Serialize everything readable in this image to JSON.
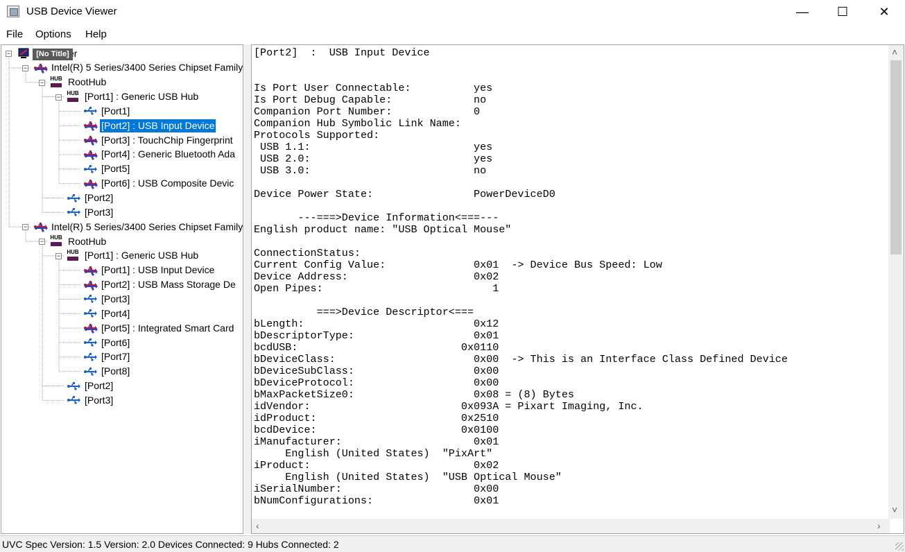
{
  "window": {
    "title": "USB Device Viewer",
    "minimize_glyph": "—",
    "maximize_glyph": "☐",
    "close_glyph": "✕"
  },
  "menu": [
    "File",
    "Options",
    "Help"
  ],
  "tooltip": "[No Title]",
  "tree": {
    "nodes": [
      {
        "label": "Computer",
        "icon": "computer-icon",
        "level": 0,
        "expanded": true
      },
      {
        "label": "Intel(R) 5 Series/3400 Series Chipset Family",
        "icon": "usb-controller-icon",
        "level": 1,
        "expanded": true
      },
      {
        "label": "RootHub",
        "icon": "hub-icon",
        "level": 2,
        "expanded": true
      },
      {
        "label": "[Port1]  :  Generic USB Hub",
        "icon": "hub-icon",
        "level": 3,
        "expanded": true
      },
      {
        "label": "[Port1]",
        "icon": "usb-port-icon",
        "level": 4
      },
      {
        "label": "[Port2]  :  USB Input Device",
        "icon": "usb-device-icon",
        "level": 4,
        "selected": true
      },
      {
        "label": "[Port3]  :  TouchChip Fingerprint",
        "icon": "usb-device-icon",
        "level": 4
      },
      {
        "label": "[Port4]  :  Generic Bluetooth Ada",
        "icon": "usb-device-icon",
        "level": 4
      },
      {
        "label": "[Port5]",
        "icon": "usb-port-icon",
        "level": 4
      },
      {
        "label": "[Port6]  :  USB Composite Devic",
        "icon": "usb-device-icon",
        "level": 4
      },
      {
        "label": "[Port2]",
        "icon": "usb-port-icon",
        "level": 3
      },
      {
        "label": "[Port3]",
        "icon": "usb-port-icon",
        "level": 3
      },
      {
        "label": "Intel(R) 5 Series/3400 Series Chipset Family",
        "icon": "usb-controller-icon",
        "level": 1,
        "expanded": true
      },
      {
        "label": "RootHub",
        "icon": "hub-icon",
        "level": 2,
        "expanded": true
      },
      {
        "label": "[Port1]  :  Generic USB Hub",
        "icon": "hub-icon",
        "level": 3,
        "expanded": true
      },
      {
        "label": "[Port1]  :  USB Input Device",
        "icon": "usb-device-icon",
        "level": 4
      },
      {
        "label": "[Port2]  :  USB Mass Storage De",
        "icon": "usb-device-icon",
        "level": 4
      },
      {
        "label": "[Port3]",
        "icon": "usb-port-icon",
        "level": 4
      },
      {
        "label": "[Port4]",
        "icon": "usb-port-icon",
        "level": 4
      },
      {
        "label": "[Port5]  :  Integrated Smart Card",
        "icon": "usb-device-icon",
        "level": 4
      },
      {
        "label": "[Port6]",
        "icon": "usb-port-icon",
        "level": 4
      },
      {
        "label": "[Port7]",
        "icon": "usb-port-icon",
        "level": 4
      },
      {
        "label": "[Port8]",
        "icon": "usb-port-icon",
        "level": 4
      },
      {
        "label": "[Port2]",
        "icon": "usb-port-icon",
        "level": 3
      },
      {
        "label": "[Port3]",
        "icon": "usb-port-icon",
        "level": 3
      }
    ]
  },
  "detail": {
    "lines": [
      "[Port2]  :  USB Input Device",
      "",
      "",
      "Is Port User Connectable:          yes",
      "Is Port Debug Capable:             no",
      "Companion Port Number:             0",
      "Companion Hub Symbolic Link Name:",
      "Protocols Supported:",
      " USB 1.1:                          yes",
      " USB 2.0:                          yes",
      " USB 3.0:                          no",
      "",
      "Device Power State:                PowerDeviceD0",
      "",
      "       ---===>Device Information<===---",
      "English product name: \"USB Optical Mouse\"",
      "",
      "ConnectionStatus:",
      "Current Config Value:              0x01  -> Device Bus Speed: Low",
      "Device Address:                    0x02",
      "Open Pipes:                           1",
      "",
      "          ===>Device Descriptor<===",
      "bLength:                           0x12",
      "bDescriptorType:                   0x01",
      "bcdUSB:                          0x0110",
      "bDeviceClass:                      0x00  -> This is an Interface Class Defined Device",
      "bDeviceSubClass:                   0x00",
      "bDeviceProtocol:                   0x00",
      "bMaxPacketSize0:                   0x08 = (8) Bytes",
      "idVendor:                        0x093A = Pixart Imaging, Inc.",
      "idProduct:                       0x2510",
      "bcdDevice:                       0x0100",
      "iManufacturer:                     0x01",
      "     English (United States)  \"PixArt\"",
      "iProduct:                          0x02",
      "     English (United States)  \"USB Optical Mouse\"",
      "iSerialNumber:                     0x00",
      "bNumConfigurations:                0x01"
    ]
  },
  "status": "UVC Spec Version: 1.5 Version: 2.0 Devices Connected: 9   Hubs Connected: 2"
}
